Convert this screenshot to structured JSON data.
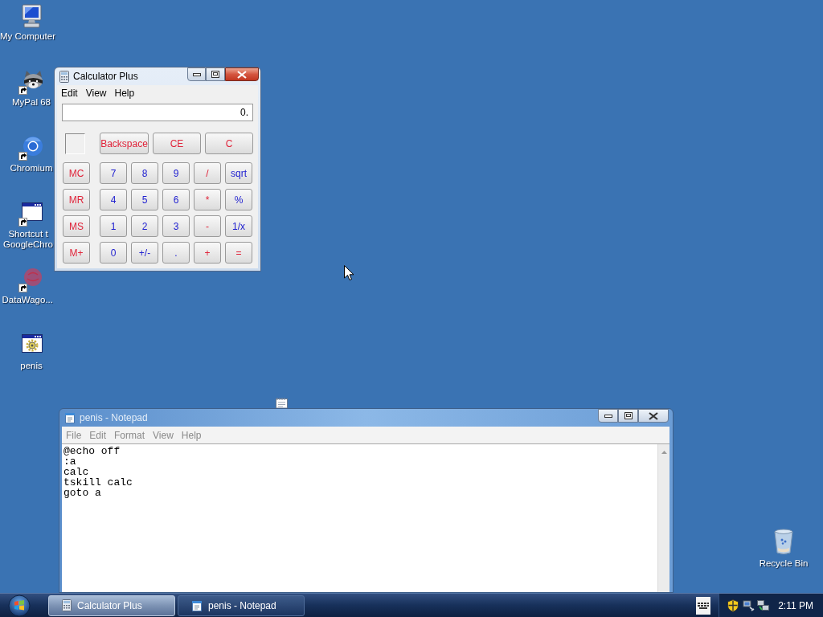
{
  "desktop_icons": [
    {
      "lines": [
        "My Computer"
      ],
      "kind": "computer",
      "shortcut": false
    },
    {
      "lines": [
        "MyPal 68"
      ],
      "kind": "raccoon",
      "shortcut": true
    },
    {
      "lines": [
        "Chromium"
      ],
      "kind": "ring",
      "shortcut": true
    },
    {
      "lines": [
        "Shortcut t",
        "GoogleChro"
      ],
      "kind": "window",
      "shortcut": true
    },
    {
      "lines": [
        "DataWago..."
      ],
      "kind": "disc",
      "shortcut": true
    },
    {
      "lines": [
        "penis"
      ],
      "kind": "batch",
      "shortcut": false
    }
  ],
  "recycle_bin": {
    "label": "Recycle Bin"
  },
  "calculator": {
    "title": "Calculator Plus",
    "active": true,
    "menu": [
      "Edit",
      "View",
      "Help"
    ],
    "display": "0.",
    "top_keys": [
      {
        "label": "Backspace"
      },
      {
        "label": "CE"
      },
      {
        "label": "C"
      }
    ],
    "keypad": [
      {
        "keys": [
          {
            "label": "MC",
            "kind": "memory"
          },
          {
            "label": "7",
            "kind": "digit"
          },
          {
            "label": "8",
            "kind": "digit"
          },
          {
            "label": "9",
            "kind": "digit"
          },
          {
            "label": "/",
            "kind": "operator"
          },
          {
            "label": "sqrt",
            "kind": "function"
          }
        ]
      },
      {
        "keys": [
          {
            "label": "MR",
            "kind": "memory"
          },
          {
            "label": "4",
            "kind": "digit"
          },
          {
            "label": "5",
            "kind": "digit"
          },
          {
            "label": "6",
            "kind": "digit"
          },
          {
            "label": "*",
            "kind": "operator"
          },
          {
            "label": "%",
            "kind": "function"
          }
        ]
      },
      {
        "keys": [
          {
            "label": "MS",
            "kind": "memory"
          },
          {
            "label": "1",
            "kind": "digit"
          },
          {
            "label": "2",
            "kind": "digit"
          },
          {
            "label": "3",
            "kind": "digit"
          },
          {
            "label": "-",
            "kind": "operator"
          },
          {
            "label": "1/x",
            "kind": "function"
          }
        ]
      },
      {
        "keys": [
          {
            "label": "M+",
            "kind": "memory"
          },
          {
            "label": "0",
            "kind": "digit"
          },
          {
            "label": "+/-",
            "kind": "digit"
          },
          {
            "label": ".",
            "kind": "digit"
          },
          {
            "label": "+",
            "kind": "operator"
          },
          {
            "label": "=",
            "kind": "operator"
          }
        ]
      }
    ]
  },
  "notepad": {
    "title": "penis - Notepad",
    "active": false,
    "menu": [
      "File",
      "Edit",
      "Format",
      "View",
      "Help"
    ],
    "text": "@echo off\n:a\ncalc\ntskill calc\ngoto a"
  },
  "taskbar": {
    "tasks": [
      {
        "label": "Calculator Plus",
        "kind": "calculator",
        "selected": true
      },
      {
        "label": "penis - Notepad",
        "kind": "notepad",
        "selected": false
      }
    ],
    "clock": "2:11 PM"
  }
}
